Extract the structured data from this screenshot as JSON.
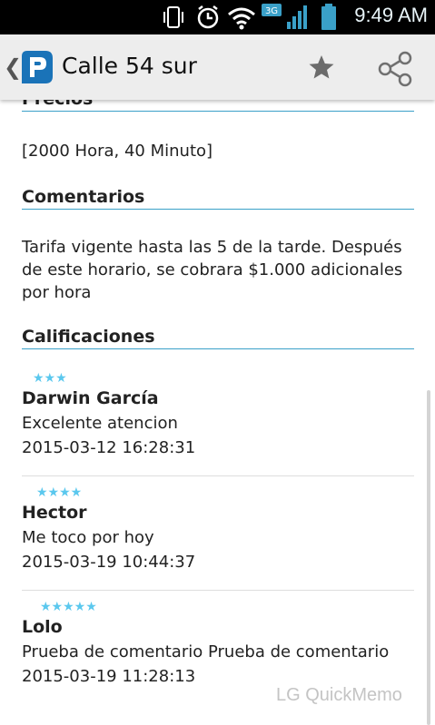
{
  "status_bar": {
    "time": "9:49 AM",
    "network_type": "3G",
    "icons": [
      "vibrate-icon",
      "alarm-icon",
      "wifi-icon",
      "signal-icon",
      "battery-icon"
    ]
  },
  "action_bar": {
    "title": "Calle 54 sur",
    "up_glyph": "❮"
  },
  "precios": {
    "header": "Precios",
    "value": "[2000 Hora, 40 Minuto]"
  },
  "comentarios": {
    "header": "Comentarios",
    "text": "Tarifa vigente hasta las 5 de la tarde. Después de este horario, se cobrara $1.000 adicionales por hora"
  },
  "calificaciones": {
    "header": "Calificaciones",
    "reviews": [
      {
        "stars": "★★★",
        "rating": 3,
        "name": "Darwin García",
        "comment": "Excelente atencion",
        "date": "2015-03-12 16:28:31"
      },
      {
        "stars": "★★★★",
        "rating": 4,
        "name": "Hector",
        "comment": "Me toco por hoy",
        "date": "2015-03-19 10:44:37"
      },
      {
        "stars": "★★★★★",
        "rating": 5,
        "name": "Lolo",
        "comment": "Prueba de comentario Prueba de comentario",
        "date": "2015-03-19 11:28:13"
      }
    ]
  },
  "watermark": "LG QuickMemo",
  "colors": {
    "accent_line": "#3aa0c8",
    "star_color": "#5bc8ee",
    "logo_blue": "#1a73b8",
    "action_bar_bg": "#ededed"
  }
}
